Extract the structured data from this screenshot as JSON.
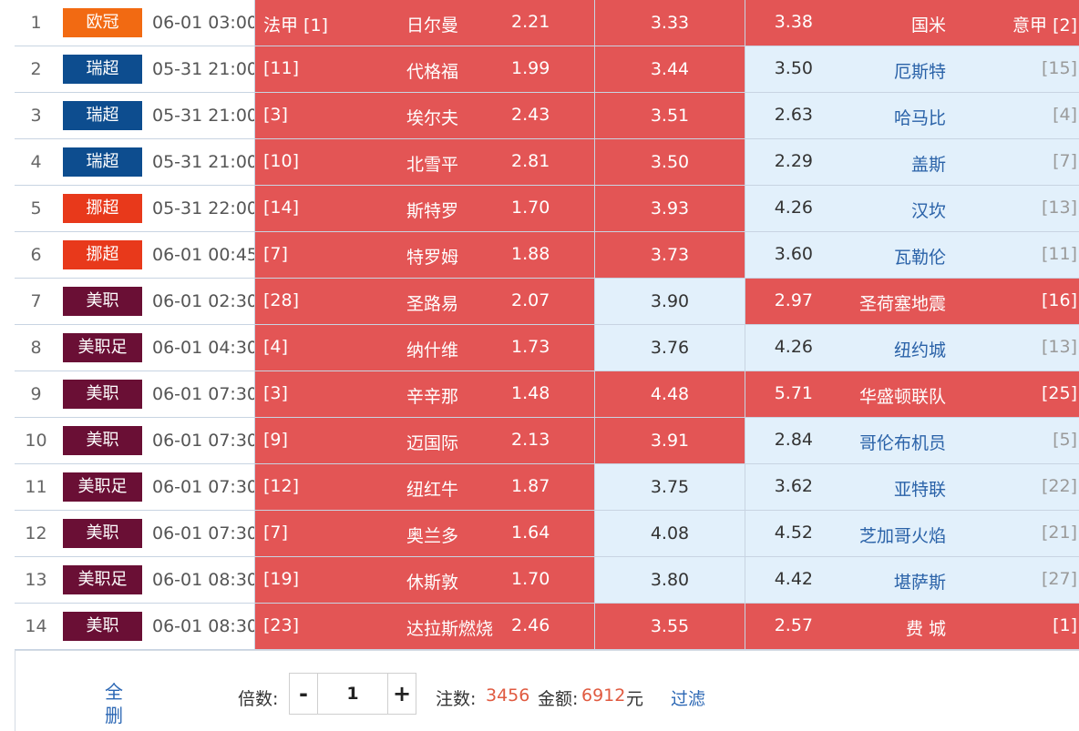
{
  "league_colors": {
    "欧冠": "#f26a12",
    "瑞超": "#0d4d8f",
    "挪超": "#e8391b",
    "美职": "#6a0f35",
    "美职足": "#6a0f35"
  },
  "colors": {
    "selected": "#e35555",
    "unselected": "#e2f0fb",
    "accent_number": "#e05a40",
    "link": "#2b67b4"
  },
  "matches": [
    {
      "index": "1",
      "league": "欧冠",
      "time": "06-01 03:00",
      "home_rank": "法甲 [1]",
      "home_team": "日尔曼",
      "home_odds": "2.21",
      "draw_odds": "3.33",
      "away_odds": "3.38",
      "away_team": "国米",
      "away_rank": "意甲 [2]",
      "home_selected": true,
      "draw_selected": true,
      "away_selected": true
    },
    {
      "index": "2",
      "league": "瑞超",
      "time": "05-31 21:00",
      "home_rank": "[11]",
      "home_team": "代格福",
      "home_odds": "1.99",
      "draw_odds": "3.44",
      "away_odds": "3.50",
      "away_team": "厄斯特",
      "away_rank": "[15]",
      "home_selected": true,
      "draw_selected": true,
      "away_selected": false
    },
    {
      "index": "3",
      "league": "瑞超",
      "time": "05-31 21:00",
      "home_rank": "[3]",
      "home_team": "埃尔夫",
      "home_odds": "2.43",
      "draw_odds": "3.51",
      "away_odds": "2.63",
      "away_team": "哈马比",
      "away_rank": "[4]",
      "home_selected": true,
      "draw_selected": true,
      "away_selected": false
    },
    {
      "index": "4",
      "league": "瑞超",
      "time": "05-31 21:00",
      "home_rank": "[10]",
      "home_team": "北雪平",
      "home_odds": "2.81",
      "draw_odds": "3.50",
      "away_odds": "2.29",
      "away_team": "盖斯",
      "away_rank": "[7]",
      "home_selected": true,
      "draw_selected": true,
      "away_selected": false
    },
    {
      "index": "5",
      "league": "挪超",
      "time": "05-31 22:00",
      "home_rank": "[14]",
      "home_team": "斯特罗",
      "home_odds": "1.70",
      "draw_odds": "3.93",
      "away_odds": "4.26",
      "away_team": "汉坎",
      "away_rank": "[13]",
      "home_selected": true,
      "draw_selected": true,
      "away_selected": false
    },
    {
      "index": "6",
      "league": "挪超",
      "time": "06-01 00:45",
      "home_rank": "[7]",
      "home_team": "特罗姆",
      "home_odds": "1.88",
      "draw_odds": "3.73",
      "away_odds": "3.60",
      "away_team": "瓦勒伦",
      "away_rank": "[11]",
      "home_selected": true,
      "draw_selected": true,
      "away_selected": false
    },
    {
      "index": "7",
      "league": "美职",
      "time": "06-01 02:30",
      "home_rank": "[28]",
      "home_team": "圣路易",
      "home_odds": "2.07",
      "draw_odds": "3.90",
      "away_odds": "2.97",
      "away_team": "圣荷塞地震",
      "away_rank": "[16]",
      "home_selected": true,
      "draw_selected": false,
      "away_selected": true
    },
    {
      "index": "8",
      "league": "美职足",
      "time": "06-01 04:30",
      "home_rank": "[4]",
      "home_team": "纳什维",
      "home_odds": "1.73",
      "draw_odds": "3.76",
      "away_odds": "4.26",
      "away_team": "纽约城",
      "away_rank": "[13]",
      "home_selected": true,
      "draw_selected": false,
      "away_selected": false
    },
    {
      "index": "9",
      "league": "美职",
      "time": "06-01 07:30",
      "home_rank": "[3]",
      "home_team": "辛辛那",
      "home_odds": "1.48",
      "draw_odds": "4.48",
      "away_odds": "5.71",
      "away_team": "华盛顿联队",
      "away_rank": "[25]",
      "home_selected": true,
      "draw_selected": true,
      "away_selected": true
    },
    {
      "index": "10",
      "league": "美职",
      "time": "06-01 07:30",
      "home_rank": "[9]",
      "home_team": "迈国际",
      "home_odds": "2.13",
      "draw_odds": "3.91",
      "away_odds": "2.84",
      "away_team": "哥伦布机员",
      "away_rank": "[5]",
      "home_selected": true,
      "draw_selected": true,
      "away_selected": false
    },
    {
      "index": "11",
      "league": "美职足",
      "time": "06-01 07:30",
      "home_rank": "[12]",
      "home_team": "纽红牛",
      "home_odds": "1.87",
      "draw_odds": "3.75",
      "away_odds": "3.62",
      "away_team": "亚特联",
      "away_rank": "[22]",
      "home_selected": true,
      "draw_selected": false,
      "away_selected": false
    },
    {
      "index": "12",
      "league": "美职",
      "time": "06-01 07:30",
      "home_rank": "[7]",
      "home_team": "奥兰多",
      "home_odds": "1.64",
      "draw_odds": "4.08",
      "away_odds": "4.52",
      "away_team": "芝加哥火焰",
      "away_rank": "[21]",
      "home_selected": true,
      "draw_selected": false,
      "away_selected": false
    },
    {
      "index": "13",
      "league": "美职足",
      "time": "06-01 08:30",
      "home_rank": "[19]",
      "home_team": "休斯敦",
      "home_odds": "1.70",
      "draw_odds": "3.80",
      "away_odds": "4.42",
      "away_team": "堪萨斯",
      "away_rank": "[27]",
      "home_selected": true,
      "draw_selected": false,
      "away_selected": false
    },
    {
      "index": "14",
      "league": "美职",
      "time": "06-01 08:30",
      "home_rank": "[23]",
      "home_team": "达拉斯燃烧",
      "home_odds": "2.46",
      "draw_odds": "3.55",
      "away_odds": "2.57",
      "away_team": "费 城",
      "away_rank": "[1]",
      "home_selected": true,
      "draw_selected": true,
      "away_selected": true
    }
  ],
  "footer": {
    "delete_all_label": "全删",
    "multiplier_label": "倍数:",
    "minus_label": "-",
    "multiplier_value": "1",
    "plus_label": "+",
    "bets_label": "注数:",
    "bets_value": "3456",
    "amount_label": "金额:",
    "amount_value": "6912",
    "amount_unit": "元",
    "filter_label": "过滤"
  }
}
